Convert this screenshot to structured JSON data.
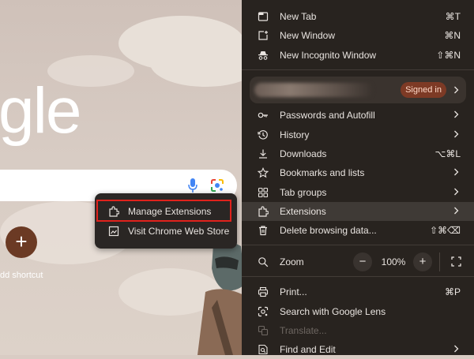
{
  "background": {
    "logo_text": "gle",
    "shortcut_symbol": "+",
    "shortcut_label": "dd shortcut"
  },
  "submenu": {
    "items": [
      {
        "label": "Manage Extensions",
        "icon": "puzzle-icon"
      },
      {
        "label": "Visit Chrome Web Store",
        "icon": "store-icon"
      }
    ]
  },
  "menu": {
    "items": [
      {
        "label": "New Tab",
        "shortcut": "⌘T",
        "icon": "new-tab-icon"
      },
      {
        "label": "New Window",
        "shortcut": "⌘N",
        "icon": "new-window-icon"
      },
      {
        "label": "New Incognito Window",
        "shortcut": "⇧⌘N",
        "icon": "incognito-icon"
      },
      {
        "label": "Passwords and Autofill",
        "icon": "key-icon"
      },
      {
        "label": "History",
        "icon": "history-icon"
      },
      {
        "label": "Downloads",
        "shortcut": "⌥⌘L",
        "icon": "download-icon"
      },
      {
        "label": "Bookmarks and lists",
        "icon": "star-icon"
      },
      {
        "label": "Tab groups",
        "icon": "tab-groups-icon"
      },
      {
        "label": "Extensions",
        "icon": "puzzle-icon"
      },
      {
        "label": "Delete browsing data...",
        "shortcut": "⇧⌘⌫",
        "icon": "trash-icon"
      },
      {
        "label": "Print...",
        "shortcut": "⌘P",
        "icon": "print-icon"
      },
      {
        "label": "Search with Google Lens",
        "icon": "lens-icon"
      },
      {
        "label": "Translate...",
        "icon": "translate-icon"
      },
      {
        "label": "Find and Edit",
        "icon": "find-icon"
      }
    ],
    "profile": {
      "signed_in_label": "Signed in"
    },
    "zoom": {
      "label": "Zoom",
      "minus": "−",
      "value": "100%",
      "plus": "+"
    }
  },
  "colors": {
    "menu_bg": "#28231f",
    "highlight_border": "#e0221c",
    "signed_in_badge": "#7d3a25"
  }
}
